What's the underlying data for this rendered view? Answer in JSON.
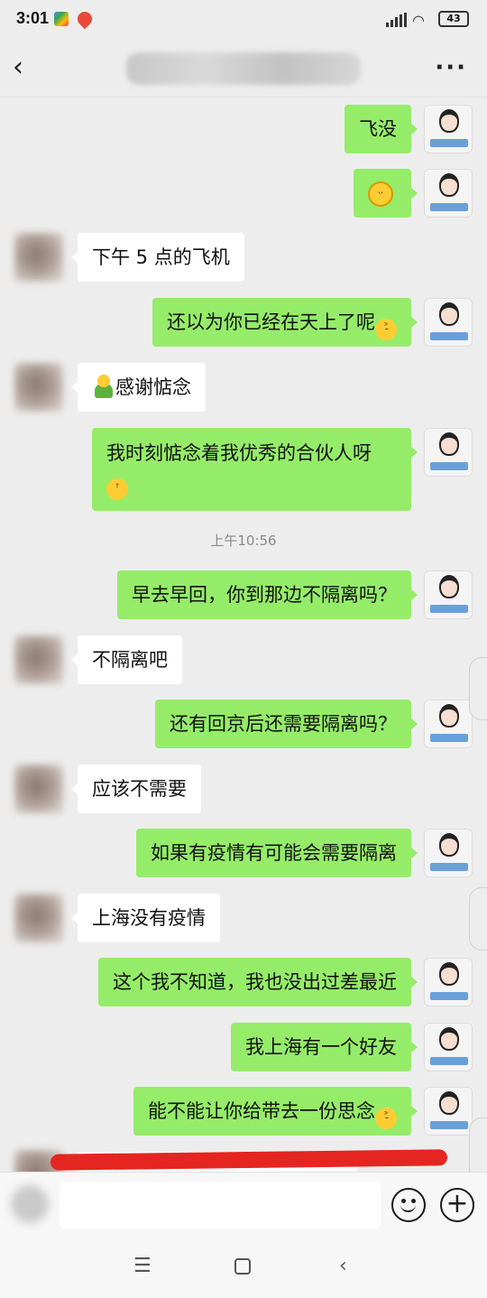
{
  "status_bar": {
    "time": "3:01",
    "battery": "43",
    "wifi_icon": "wifi-icon",
    "signal_icon": "signal-icon"
  },
  "header": {
    "title": "",
    "back_icon": "‹",
    "more_icon": "···"
  },
  "messages": [
    {
      "from": "me",
      "text": "飞没"
    },
    {
      "from": "me",
      "text": "",
      "emoji": "grin"
    },
    {
      "from": "other",
      "text": "下午 5 点的飞机"
    },
    {
      "from": "me",
      "text": "还以为你已经在天上了呢",
      "emoji_after": "laugh-cry"
    },
    {
      "from": "other",
      "text": "感谢惦念",
      "emoji_before": "hug"
    },
    {
      "from": "me",
      "text": "我时刻惦念着我优秀的合伙人呀",
      "emoji_after": "thinking"
    },
    {
      "from": "system",
      "text": "上午10:56"
    },
    {
      "from": "me",
      "text": "早去早回，你到那边不隔离吗？"
    },
    {
      "from": "other",
      "text": "不隔离吧"
    },
    {
      "from": "me",
      "text": "还有回京后还需要隔离吗？"
    },
    {
      "from": "other",
      "text": "应该不需要"
    },
    {
      "from": "me",
      "text": "如果有疫情有可能会需要隔离"
    },
    {
      "from": "other",
      "text": "上海没有疫情"
    },
    {
      "from": "me",
      "text": "这个我不知道，我也没出过差最近"
    },
    {
      "from": "me",
      "text": "我上海有一个好友"
    },
    {
      "from": "me",
      "text": "能不能让你给带去一份思念",
      "emoji_after": "laugh-cry"
    }
  ],
  "input": {
    "value": ""
  },
  "colors": {
    "my_bubble": "#95ec69",
    "other_bubble": "#ffffff",
    "background": "#ededed",
    "redline": "#e52521"
  },
  "system_nav": {
    "menu_icon": "☰",
    "back_icon": "‹"
  }
}
